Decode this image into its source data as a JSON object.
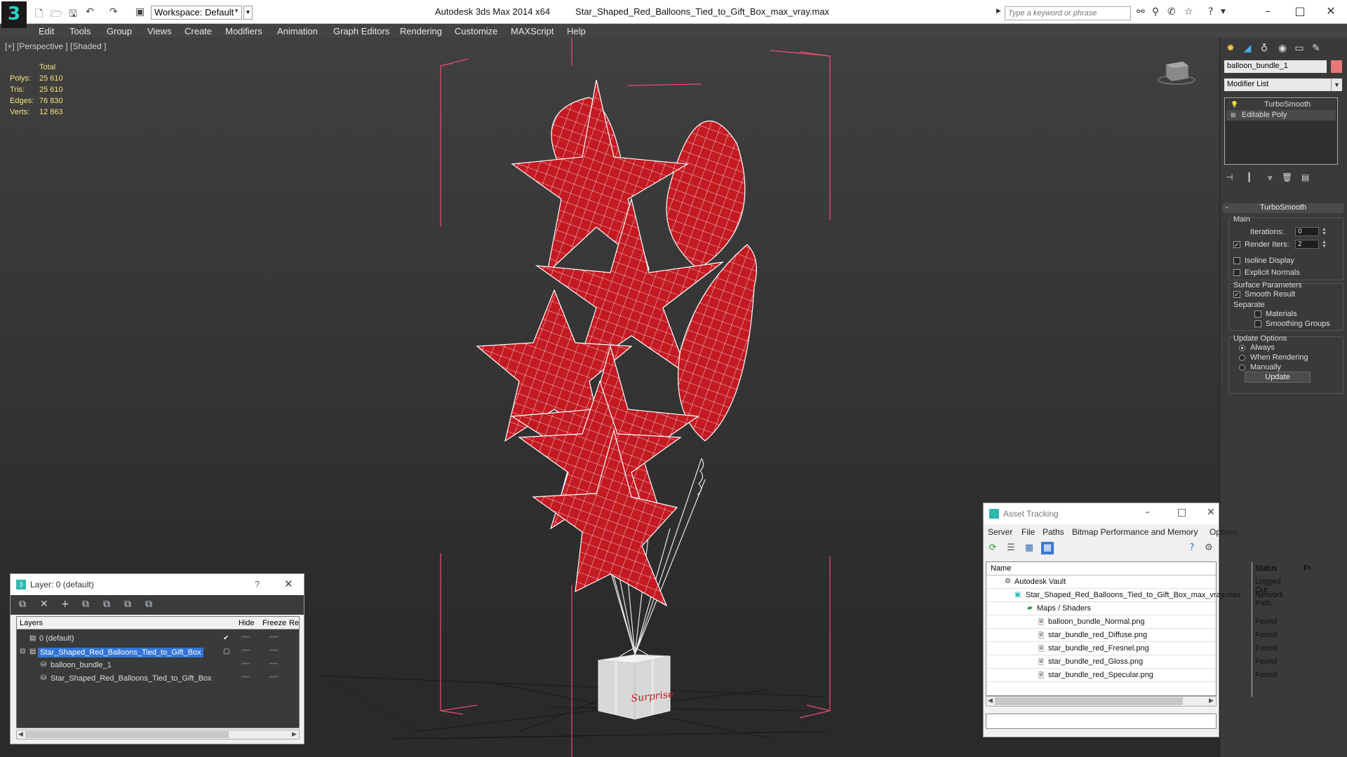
{
  "titlebar": {
    "workspace": "Workspace: Default",
    "app_title": "Autodesk 3ds Max  2014 x64",
    "file_name": "Star_Shaped_Red_Balloons_Tied_to_Gift_Box_max_vray.max",
    "search_placeholder": "Type a keyword or phrase",
    "icons": [
      "new-icon",
      "open-icon",
      "save-icon",
      "undo-icon",
      "redo-icon",
      "project-icon",
      "binoculars-icon",
      "search-icon",
      "star-icon",
      "help-icon"
    ]
  },
  "menubar": {
    "items": [
      "Edit",
      "Tools",
      "Group",
      "Views",
      "Create",
      "Modifiers",
      "Animation",
      "Graph Editors",
      "Rendering",
      "Customize",
      "MAXScript",
      "Help"
    ]
  },
  "viewport": {
    "label": "[+] [Perspective ] [Shaded ]",
    "stats": {
      "total_label": "Total",
      "rows": [
        {
          "label": "Polys:",
          "value": "25 610"
        },
        {
          "label": "Tris:",
          "value": "25 610"
        },
        {
          "label": "Edges:",
          "value": "76 830"
        },
        {
          "label": "Verts:",
          "value": "12 863"
        }
      ]
    },
    "box_text": "Surprise",
    "balloon_color": "#c41a22",
    "wire_color": "#ffffff",
    "bbox_color": "#e24b6d"
  },
  "command_panel": {
    "object_name": "balloon_bundle_1",
    "object_color": "#e8787a",
    "modifier_list": "Modifier List",
    "stack": [
      "TurboSmooth",
      "Editable Poly"
    ],
    "rollout": {
      "title": "TurboSmooth",
      "main_group": "Main",
      "iterations_label": "Iterations:",
      "iterations_value": "0",
      "render_iters_label": "Render Iters:",
      "render_iters_value": "2",
      "isoline": "Isoline Display",
      "explicit_normals": "Explicit Normals",
      "surface_group": "Surface Parameters",
      "smooth_result": "Smooth Result",
      "separate": "Separate",
      "materials": "Materials",
      "smoothing_groups": "Smoothing Groups",
      "update_group": "Update Options",
      "always": "Always",
      "when_rendering": "When Rendering",
      "manually": "Manually",
      "update_button": "Update"
    }
  },
  "layer_window": {
    "title": "Layer: 0 (default)",
    "help": "?",
    "columns": [
      "Layers",
      "Hide",
      "Freeze",
      "Re"
    ],
    "rows": [
      {
        "name": "0 (default)"
      },
      {
        "name": "Star_Shaped_Red_Balloons_Tied_to_Gift_Box"
      },
      {
        "name": "balloon_bundle_1"
      },
      {
        "name": "Star_Shaped_Red_Balloons_Tied_to_Gift_Box"
      }
    ]
  },
  "asset_window": {
    "title": "Asset Tracking",
    "menu": [
      "Server",
      "File",
      "Paths",
      "Bitmap Performance and Memory",
      "Options"
    ],
    "columns": [
      "Name",
      "Status",
      "Pr"
    ],
    "rows": [
      {
        "name": "Autodesk Vault",
        "status": "Logged Out ..."
      },
      {
        "name": "Star_Shaped_Red_Balloons_Tied_to_Gift_Box_max_vray.max",
        "status": "Network Path"
      },
      {
        "name": "Maps / Shaders",
        "status": ""
      },
      {
        "name": "balloon_bundle_Normal.png",
        "status": "Found"
      },
      {
        "name": "star_bundle_red_Diffuse.png",
        "status": "Found"
      },
      {
        "name": "star_bundle_red_Fresnel.png",
        "status": "Found"
      },
      {
        "name": "star_bundle_red_Gloss.png",
        "status": "Found"
      },
      {
        "name": "star_bundle_red_Specular.png",
        "status": "Found"
      }
    ]
  }
}
